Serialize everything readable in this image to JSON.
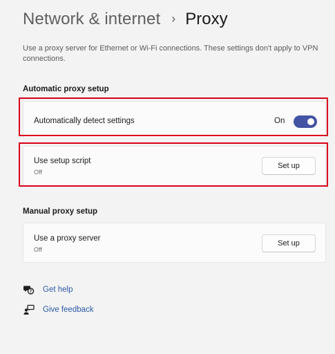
{
  "header": {
    "parent": "Network & internet",
    "separator": "›",
    "current": "Proxy"
  },
  "description": "Use a proxy server for Ethernet or Wi-Fi connections. These settings don't apply to VPN connections.",
  "automatic": {
    "heading": "Automatic proxy setup",
    "detect": {
      "label": "Automatically detect settings",
      "toggle_label": "On",
      "toggle_on": true
    },
    "script": {
      "label": "Use setup script",
      "status": "Off",
      "button": "Set up"
    }
  },
  "manual": {
    "heading": "Manual proxy setup",
    "server": {
      "label": "Use a proxy server",
      "status": "Off",
      "button": "Set up"
    }
  },
  "links": {
    "help": {
      "label": "Get help",
      "icon": "help-chat-icon"
    },
    "feedback": {
      "label": "Give feedback",
      "icon": "feedback-person-icon"
    }
  },
  "colors": {
    "accent": "#4254a3",
    "highlight": "#d9001b",
    "link": "#2d5aa8"
  }
}
